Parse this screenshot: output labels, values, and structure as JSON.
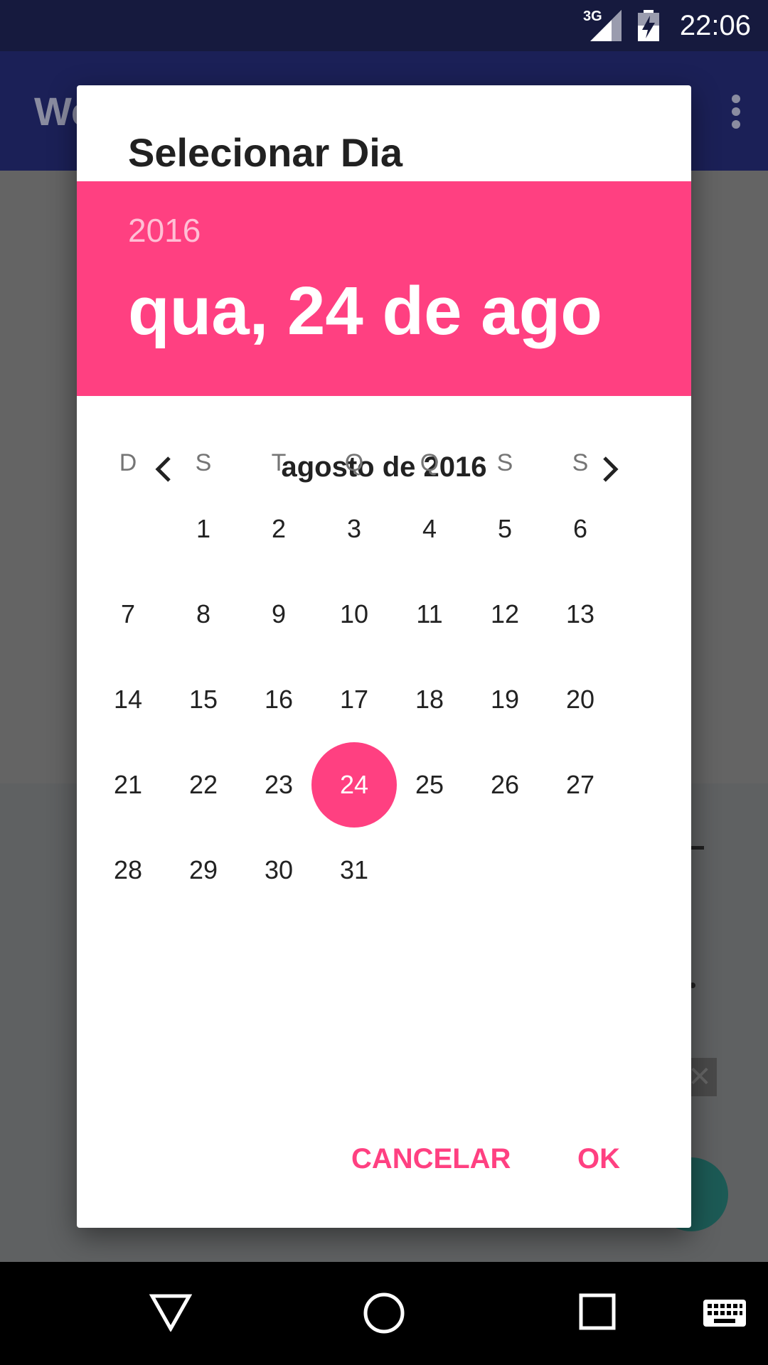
{
  "status_bar": {
    "time": "22:06",
    "network": "3G"
  },
  "app_bar": {
    "title_partial": "We"
  },
  "dialog": {
    "title": "Selecionar Dia",
    "year": "2016",
    "date": "qua, 24 de ago",
    "month_label": "agosto de 2016",
    "weekdays": [
      "D",
      "S",
      "T",
      "Q",
      "Q",
      "S",
      "S"
    ],
    "weeks": [
      [
        "",
        "1",
        "2",
        "3",
        "4",
        "5",
        "6"
      ],
      [
        "7",
        "8",
        "9",
        "10",
        "11",
        "12",
        "13"
      ],
      [
        "14",
        "15",
        "16",
        "17",
        "18",
        "19",
        "20"
      ],
      [
        "21",
        "22",
        "23",
        "24",
        "25",
        "26",
        "27"
      ],
      [
        "28",
        "29",
        "30",
        "31",
        "",
        "",
        ""
      ]
    ],
    "selected_day": "24",
    "cancel_label": "CANCELAR",
    "ok_label": "OK"
  },
  "colors": {
    "accent": "#ff4081",
    "status_bar": "#161a3e",
    "app_bar": "#1b2057"
  }
}
